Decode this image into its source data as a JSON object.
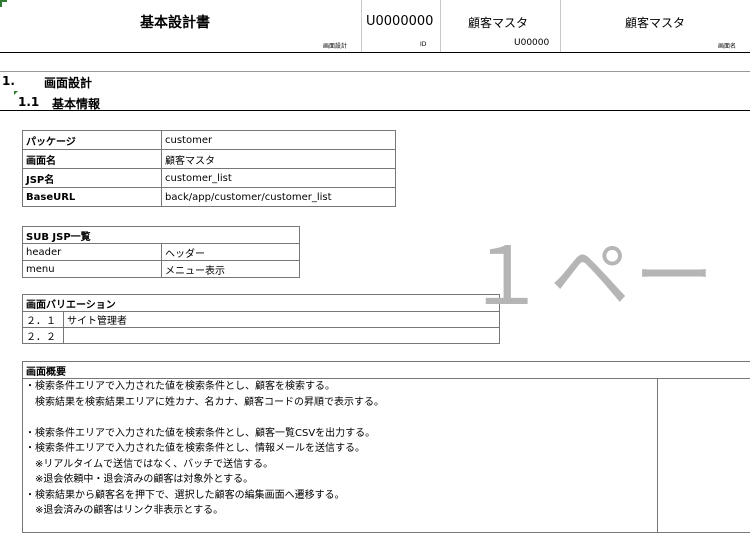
{
  "header": {
    "doc_title": "基本設計書",
    "doc_title_sub": "画面設計",
    "screen_id": "U0000000",
    "screen_id_sub": "ID",
    "screen_name_1": "顧客マスタ",
    "screen_code": "U00000",
    "screen_name_2": "顧客マスタ",
    "screen_name_sub": "画面名"
  },
  "section": {
    "number": "1.",
    "title": "画面設計",
    "sub_number": "1.1",
    "sub_title": "基本情報"
  },
  "basic_info": [
    {
      "label": "パッケージ",
      "value": "customer"
    },
    {
      "label": "画面名",
      "value": "顧客マスタ"
    },
    {
      "label": "JSP名",
      "value": "customer_list"
    },
    {
      "label": "BaseURL",
      "value": "back/app/customer/customer_list"
    }
  ],
  "sub_jsp": {
    "title": "SUB JSP一覧",
    "rows": [
      {
        "name": "header",
        "desc": "ヘッダー"
      },
      {
        "name": "menu",
        "desc": "メニュー表示"
      }
    ]
  },
  "variation": {
    "title": "画面バリエーション",
    "rows": [
      {
        "no": "２．１",
        "desc": "サイト管理者"
      },
      {
        "no": "２．２",
        "desc": ""
      }
    ]
  },
  "overview": {
    "title": "画面概要",
    "lines": [
      "・検索条件エリアで入力された値を検索条件とし、顧客を検索する。",
      "　検索結果を検索結果エリアに姓カナ、名カナ、顧客コードの昇順で表示する。",
      "",
      "・検索条件エリアで入力された値を検索条件とし、顧客一覧CSVを出力する。",
      "・検索条件エリアで入力された値を検索条件とし、情報メールを送信する。",
      "　※リアルタイムで送信ではなく、バッチで送信する。",
      "　※退会依頼中・退会済みの顧客は対象外とする。",
      "・検索結果から顧客名を押下で、選択した顧客の編集画面へ遷移する。",
      "　※退会済みの顧客はリンク非表示とする。"
    ]
  },
  "watermark": "１ペー"
}
